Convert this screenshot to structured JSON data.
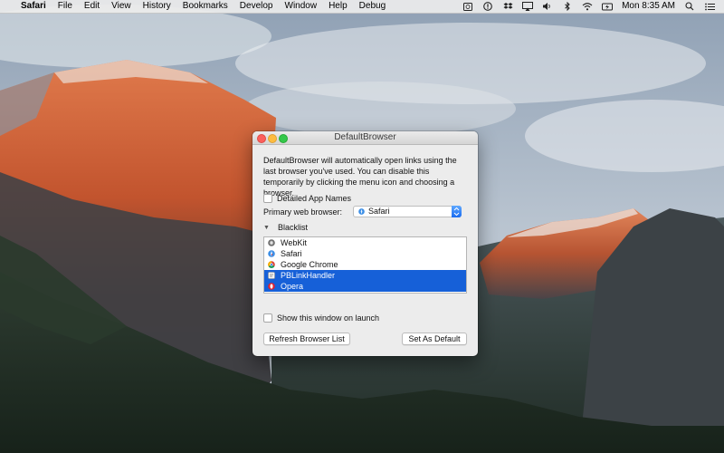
{
  "menubar": {
    "apple": "",
    "app_name": "Safari",
    "menus": [
      "File",
      "Edit",
      "View",
      "History",
      "Bookmarks",
      "Develop",
      "Window",
      "Help",
      "Debug"
    ],
    "status_icons": [
      "defaultbrowser-icon",
      "alert-icon",
      "dropbox-icon",
      "airplay-icon",
      "volume-icon",
      "bluetooth-icon",
      "wifi-icon",
      "battery-icon"
    ],
    "clock": "Mon 8:35 AM",
    "search_icon": "search-icon",
    "notification_icon": "notification-center-icon"
  },
  "window": {
    "title": "DefaultBrowser",
    "description": "DefaultBrowser will automatically open links using the last browser you've used. You can disable this temporarily by clicking the menu icon and choosing a browser.",
    "detailed_names_label": "Detailed App Names",
    "detailed_names_checked": false,
    "primary_label": "Primary web browser:",
    "primary_value": "Safari",
    "blacklist_label": "Blacklist",
    "blacklist": [
      {
        "label": "WebKit",
        "icon": "webkit-icon",
        "selected": false
      },
      {
        "label": "Safari",
        "icon": "safari-icon",
        "selected": false
      },
      {
        "label": "Google Chrome",
        "icon": "chrome-icon",
        "selected": false
      },
      {
        "label": "PBLinkHandler",
        "icon": "pblinkhandler-icon",
        "selected": true
      },
      {
        "label": "Opera",
        "icon": "opera-icon",
        "selected": true
      }
    ],
    "show_on_launch_label": "Show this window on launch",
    "show_on_launch_checked": false,
    "refresh_label": "Refresh Browser List",
    "set_default_label": "Set As Default"
  },
  "colors": {
    "selection": "#1660d8",
    "close": "#fc605c",
    "minimize": "#fdbc40",
    "zoom": "#34c84a"
  }
}
